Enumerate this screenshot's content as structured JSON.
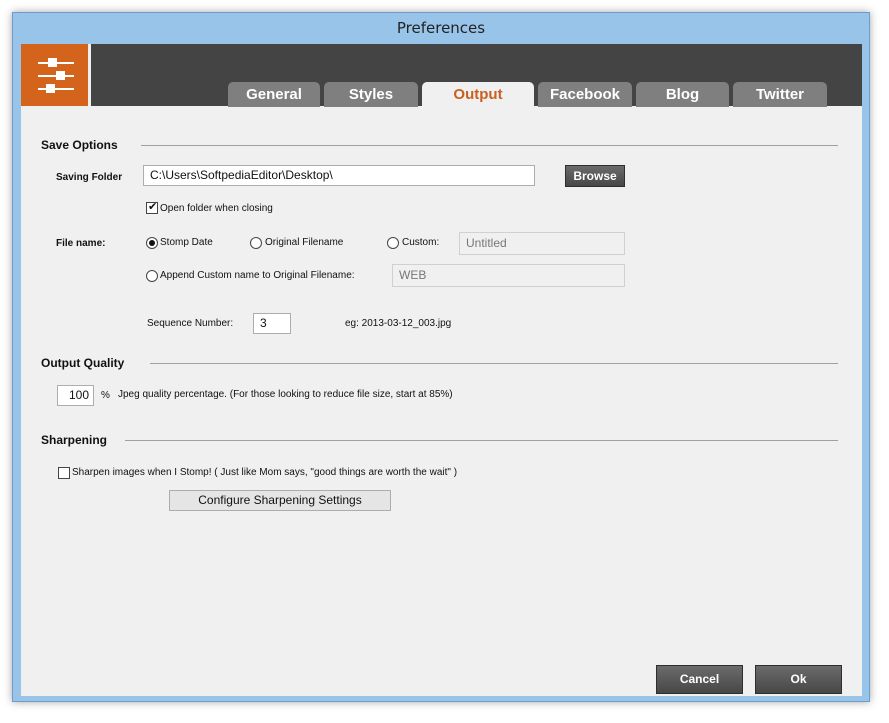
{
  "window": {
    "title": "Preferences"
  },
  "header": {
    "logo_icon": "sliders-icon",
    "accent_color": "#d4631b",
    "tabs": [
      {
        "label": "General",
        "active": false
      },
      {
        "label": "Styles",
        "active": false
      },
      {
        "label": "Output",
        "active": true
      },
      {
        "label": "Facebook",
        "active": false
      },
      {
        "label": "Blog",
        "active": false
      },
      {
        "label": "Twitter",
        "active": false
      }
    ]
  },
  "save_options": {
    "title": "Save Options",
    "saving_folder_label": "Saving Folder",
    "saving_folder_value": "C:\\Users\\SoftpediaEditor\\Desktop\\",
    "browse_label": "Browse",
    "open_folder_label": "Open folder when closing",
    "open_folder_checked": true,
    "file_name_label": "File name:",
    "stomp_date_label": "Stomp Date",
    "original_filename_label": "Original Filename",
    "custom_label": "Custom:",
    "custom_value": "Untitled",
    "append_custom_label": "Append Custom name to Original Filename:",
    "append_value": "WEB",
    "selected_option": "Stomp Date",
    "sequence_label": "Sequence Number:",
    "sequence_value": "3",
    "example_label": "eg: 2013-03-12_003.jpg"
  },
  "output_quality": {
    "title": "Output Quality",
    "quality_value": "100",
    "percent_sign": "%",
    "description": "Jpeg quality percentage.  (For those looking to reduce file size, start at 85%)"
  },
  "sharpening": {
    "title": "Sharpening",
    "sharpen_label": "Sharpen images when I Stomp! ( Just like Mom says, \"good things are worth the wait\" )",
    "sharpen_checked": false,
    "configure_label": "Configure Sharpening Settings"
  },
  "footer": {
    "cancel_label": "Cancel",
    "ok_label": "Ok"
  }
}
